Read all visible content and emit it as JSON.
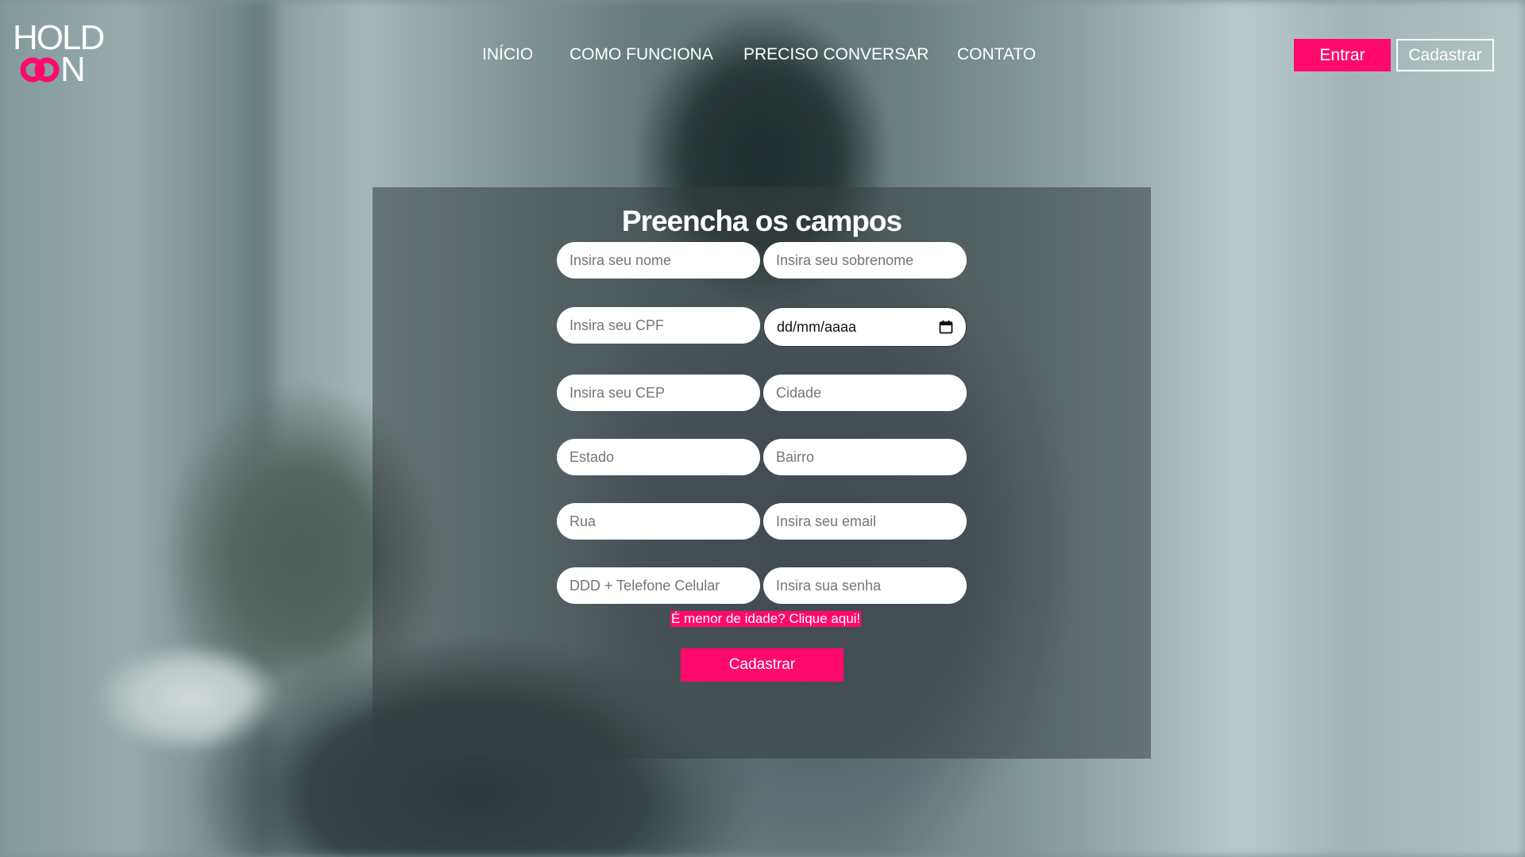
{
  "logo": {
    "line1": "HOLD",
    "line2_letter": "N",
    "accent_color": "#ff0a6c",
    "icon": "interlocked-rings-icon"
  },
  "nav": {
    "items": [
      {
        "label": "INÍCIO"
      },
      {
        "label": "COMO FUNCIONA"
      },
      {
        "label": "PRECISO CONVERSAR"
      },
      {
        "label": "CONTATO"
      }
    ]
  },
  "header": {
    "login_label": "Entrar",
    "signup_label": "Cadastrar"
  },
  "form": {
    "title": "Preencha os campos",
    "fields": {
      "nome": {
        "placeholder": "Insira seu nome"
      },
      "sobrenome": {
        "placeholder": "Insira seu sobrenome"
      },
      "cpf": {
        "placeholder": "Insira seu CPF"
      },
      "nascimento": {
        "value": "dd/mm/aaaa",
        "icon": "calendar-icon"
      },
      "cep": {
        "placeholder": "Insira seu CEP"
      },
      "cidade": {
        "placeholder": "Cidade"
      },
      "estado": {
        "placeholder": "Estado"
      },
      "bairro": {
        "placeholder": "Bairro"
      },
      "rua": {
        "placeholder": "Rua"
      },
      "email": {
        "placeholder": "Insira seu email"
      },
      "telefone": {
        "placeholder": "DDD + Telefone Celular"
      },
      "senha": {
        "placeholder": "Insira sua senha"
      }
    },
    "minor_link": "É menor de idade? Clique aqui!",
    "submit_label": "Cadastrar"
  },
  "colors": {
    "accent": "#ff0a6c",
    "text_light": "#ffffff"
  }
}
